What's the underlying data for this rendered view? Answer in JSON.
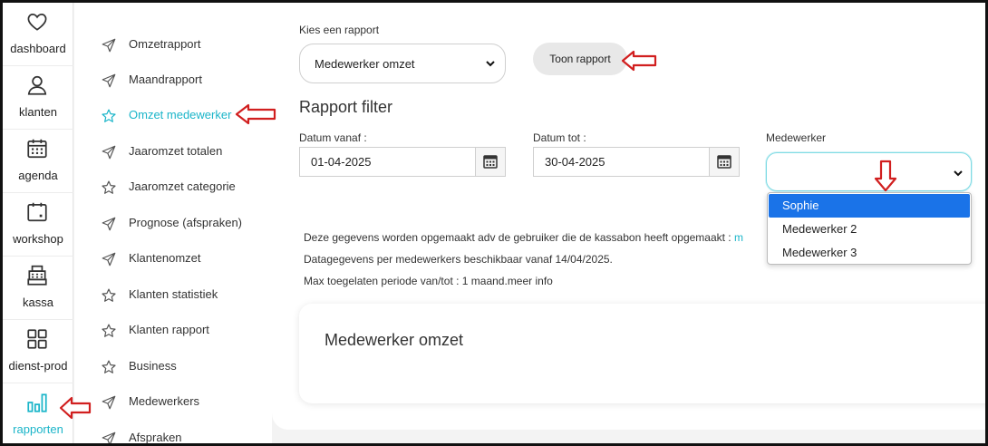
{
  "nav": [
    {
      "label": "dashboard",
      "icon": "heart-icon"
    },
    {
      "label": "klanten",
      "icon": "user-icon"
    },
    {
      "label": "agenda",
      "icon": "calendar-icon"
    },
    {
      "label": "workshop",
      "icon": "workshop-calendar-icon"
    },
    {
      "label": "kassa",
      "icon": "cash-register-icon"
    },
    {
      "label": "dienst-prod",
      "icon": "grid-icon"
    },
    {
      "label": "rapporten",
      "icon": "bar-chart-icon"
    }
  ],
  "menu": [
    {
      "label": "Omzetrapport",
      "icon": "send-icon"
    },
    {
      "label": "Maandrapport",
      "icon": "send-icon"
    },
    {
      "label": "Omzet medewerker",
      "icon": "star-icon"
    },
    {
      "label": "Jaaromzet totalen",
      "icon": "send-icon"
    },
    {
      "label": "Jaaromzet categorie",
      "icon": "star-icon"
    },
    {
      "label": "Prognose (afspraken)",
      "icon": "send-icon"
    },
    {
      "label": "Klantenomzet",
      "icon": "send-icon"
    },
    {
      "label": "Klanten statistiek",
      "icon": "star-icon"
    },
    {
      "label": "Klanten rapport",
      "icon": "star-icon"
    },
    {
      "label": "Business",
      "icon": "star-icon"
    },
    {
      "label": "Medewerkers",
      "icon": "send-icon"
    },
    {
      "label": "Afspraken",
      "icon": "send-icon"
    }
  ],
  "report": {
    "choose_label": "Kies een rapport",
    "selected": "Medewerker omzet",
    "show_button": "Toon rapport"
  },
  "filter": {
    "title": "Rapport filter",
    "date_from_label": "Datum vanaf :",
    "date_from": "01-04-2025",
    "date_to_label": "Datum tot :",
    "date_to": "30-04-2025",
    "employee_label": "Medewerker",
    "employee_value": ""
  },
  "employee_options": [
    "Sophie",
    "Medewerker 2",
    "Medewerker 3"
  ],
  "info": {
    "line1": "Deze gegevens worden opgemaakt adv de gebruiker die de kassabon heeft opgemaakt : ",
    "line1_link": "m",
    "line2": "Datagegevens per medewerkers beschikbaar vanaf 14/04/2025.",
    "line3": "Max toegelaten periode van/tot : 1 maand.meer info"
  },
  "card": {
    "title": "Medewerker omzet"
  },
  "colors": {
    "accent": "#1bb5c9",
    "arrow": "#d11f1f",
    "selected_option": "#1a73e8"
  }
}
